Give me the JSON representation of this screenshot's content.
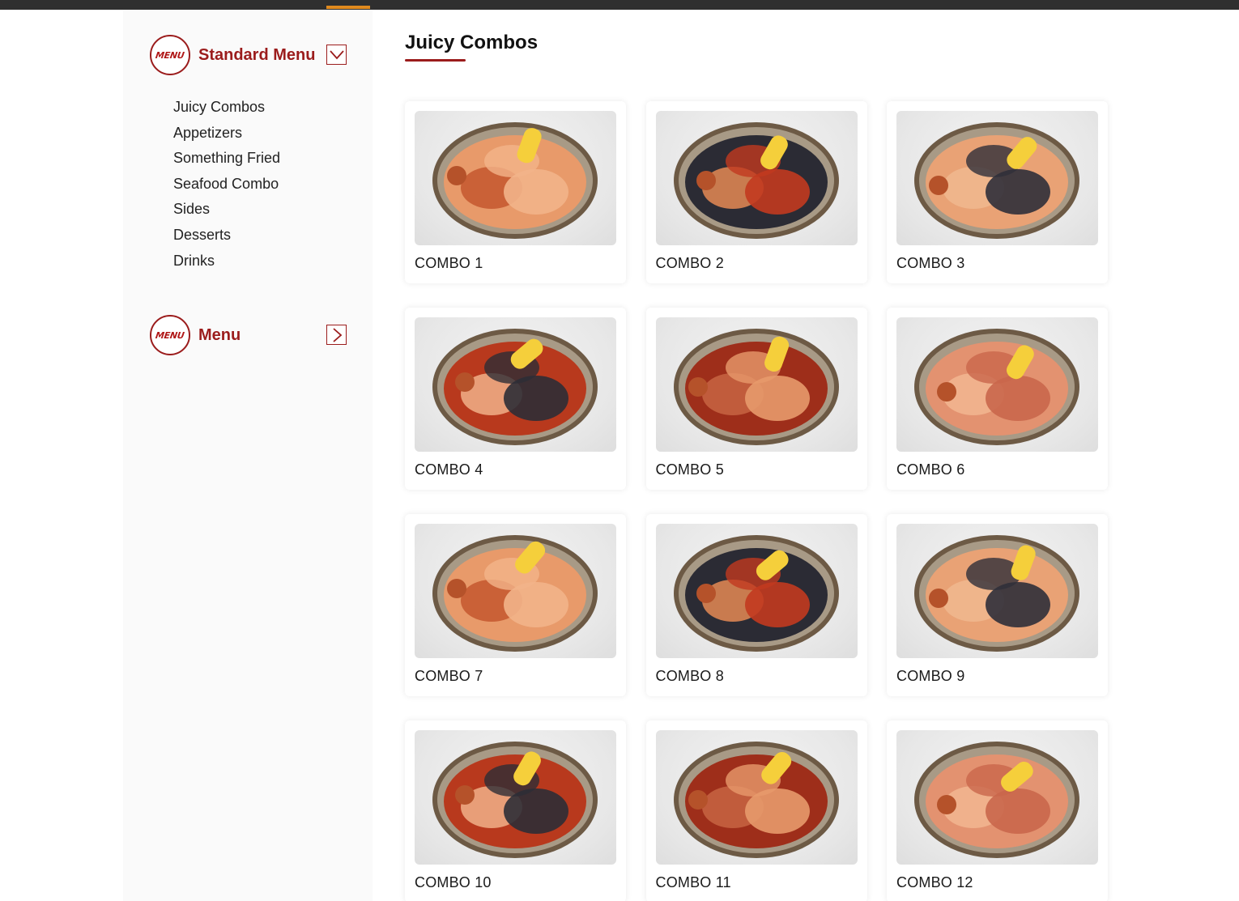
{
  "colors": {
    "brand_red": "#9b1c1c",
    "accent_orange": "#e08a1e",
    "topbar": "#2f2f2f"
  },
  "sidebar": {
    "groups": [
      {
        "badge_text": "MENU",
        "title": "Standard Menu",
        "toggle_icon": "chevron-down-icon",
        "expanded": true
      },
      {
        "badge_text": "MENU",
        "title": "Menu",
        "toggle_icon": "chevron-right-icon",
        "expanded": false
      }
    ],
    "categories": [
      "Juicy Combos",
      "Appetizers",
      "Something Fried",
      "Seafood Combo",
      "Sides",
      "Desserts",
      "Drinks"
    ]
  },
  "main": {
    "section_title": "Juicy Combos",
    "items": [
      {
        "name": "COMBO 1",
        "image_icon": "seafood-boil-photo"
      },
      {
        "name": "COMBO 2",
        "image_icon": "seafood-boil-photo"
      },
      {
        "name": "COMBO 3",
        "image_icon": "seafood-boil-photo"
      },
      {
        "name": "COMBO 4",
        "image_icon": "seafood-boil-photo"
      },
      {
        "name": "COMBO 5",
        "image_icon": "seafood-boil-photo"
      },
      {
        "name": "COMBO 6",
        "image_icon": "seafood-boil-photo"
      },
      {
        "name": "COMBO 7",
        "image_icon": "seafood-boil-photo"
      },
      {
        "name": "COMBO 8",
        "image_icon": "seafood-boil-photo"
      },
      {
        "name": "COMBO 9",
        "image_icon": "seafood-boil-photo"
      },
      {
        "name": "COMBO 10",
        "image_icon": "seafood-boil-photo"
      },
      {
        "name": "COMBO 11",
        "image_icon": "seafood-boil-photo"
      },
      {
        "name": "COMBO 12",
        "image_icon": "seafood-boil-photo"
      }
    ]
  }
}
